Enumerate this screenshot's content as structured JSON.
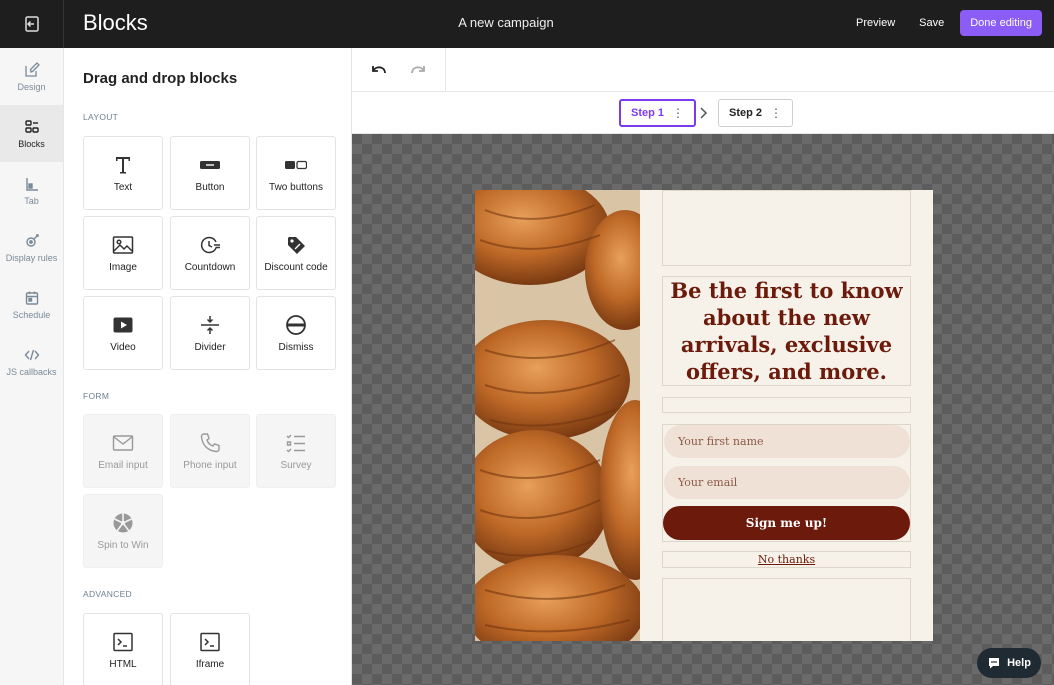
{
  "header": {
    "app_title": "Blocks",
    "campaign_name": "A new campaign",
    "preview_label": "Preview",
    "save_label": "Save",
    "done_label": "Done editing",
    "accent_color": "#8b5cf6"
  },
  "rail": {
    "items": [
      {
        "label": "Design",
        "icon": "pen-square-icon"
      },
      {
        "label": "Blocks",
        "icon": "blocks-icon",
        "active": true
      },
      {
        "label": "Tab",
        "icon": "tab-icon"
      },
      {
        "label": "Display rules",
        "icon": "target-icon"
      },
      {
        "label": "Schedule",
        "icon": "calendar-icon"
      },
      {
        "label": "JS callbacks",
        "icon": "code-icon"
      }
    ]
  },
  "panel": {
    "title": "Drag and drop blocks",
    "sections": {
      "layout": "LAYOUT",
      "form": "FORM",
      "advanced": "ADVANCED"
    },
    "layout_blocks": [
      "Text",
      "Button",
      "Two buttons",
      "Image",
      "Countdown",
      "Discount code",
      "Video",
      "Divider",
      "Dismiss"
    ],
    "form_blocks": [
      "Email input",
      "Phone input",
      "Survey",
      "Spin to Win"
    ],
    "advanced_blocks": [
      "HTML",
      "Iframe"
    ]
  },
  "steps": {
    "items": [
      {
        "label": "Step 1",
        "active": true
      },
      {
        "label": "Step 2",
        "active": false
      }
    ]
  },
  "popup": {
    "headline": "Be the first to know about the new arrivals, exclusive offers, and more.",
    "first_name_placeholder": "Your first name",
    "email_placeholder": "Your email",
    "cta_label": "Sign me up!",
    "dismiss_label": "No thanks",
    "brand_color": "#6b1a0c",
    "background_color": "#f7f2e9"
  },
  "help_label": "Help"
}
